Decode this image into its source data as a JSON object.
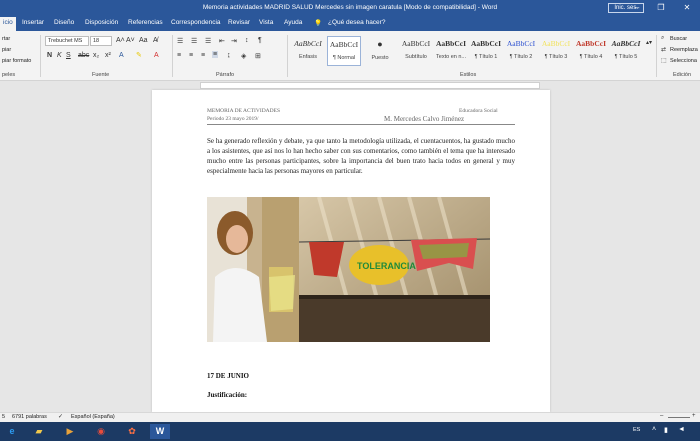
{
  "window": {
    "title": "Memoria actividades MADRID SALUD Mercedes sin imagen caratula [Modo de compatibilidad] - Word",
    "signin": "Inic. ses.",
    "minimize": "–",
    "restore": "❐",
    "close": "✕"
  },
  "tabs": [
    "icio",
    "Insertar",
    "Diseño",
    "Disposición",
    "Referencias",
    "Correspondencia",
    "Revisar",
    "Vista",
    "Ayuda"
  ],
  "tell_me": "¿Qué desea hacer?",
  "clipboard": {
    "cut": "rtar",
    "copy": "piar",
    "format": "piar formato",
    "label": "peles"
  },
  "font": {
    "family": "Trebuchet MS",
    "size": "18",
    "label": "Fuente"
  },
  "paragraph": {
    "label": "Párrafo"
  },
  "styles": {
    "label": "Estilos",
    "items": [
      {
        "sample": "AaBbCcI",
        "name": "Énfasis"
      },
      {
        "sample": "AaBbCcI",
        "name": "¶ Normal"
      },
      {
        "sample": "●",
        "name": "Puesto"
      },
      {
        "sample": "AaBbCcI",
        "name": "Subtítulo"
      },
      {
        "sample": "AaBbCcI",
        "name": "Texto en n..."
      },
      {
        "sample": "AaBbCcI",
        "name": "¶ Título 1"
      },
      {
        "sample": "AaBbCcI",
        "name": "¶ Título 2"
      },
      {
        "sample": "AaBbCcI",
        "name": "¶ Título 3"
      },
      {
        "sample": "AaBbCcI",
        "name": "¶ Título 4"
      },
      {
        "sample": "AaBbCcI",
        "name": "¶ Título 5"
      }
    ]
  },
  "editing": {
    "find": "Buscar",
    "replace": "Reemplaza",
    "select": "Selecciona",
    "label": "Edición"
  },
  "document": {
    "header_left_1": "MEMORIA DE ACTIVIDADES",
    "header_left_2": "Periodo 23 mayo 2019/",
    "header_right_1": "Educadora Social",
    "header_right_2": "M. Mercedes Calvo Jiménez",
    "paragraph": "Se ha generado reflexión y debate, ya que tanto la metodología utilizada, el cuentacuentos, ha gustado mucho a los asistentes, que así nos lo han hecho saber con sus comentarios, como también el tema que ha interesado mucho entre las personas participantes, sobre la importancia del buen trato hacia todos en general y muy especialmente hacia las personas mayores en particular.",
    "banner_text": "TOLERANCIA",
    "section_date": "17 DE JUNIO",
    "section_label": "Justificación:"
  },
  "status": {
    "page": "5",
    "words": "6791 palabras",
    "language": "Español (España)"
  },
  "taskbar": {
    "lang": "ES"
  }
}
